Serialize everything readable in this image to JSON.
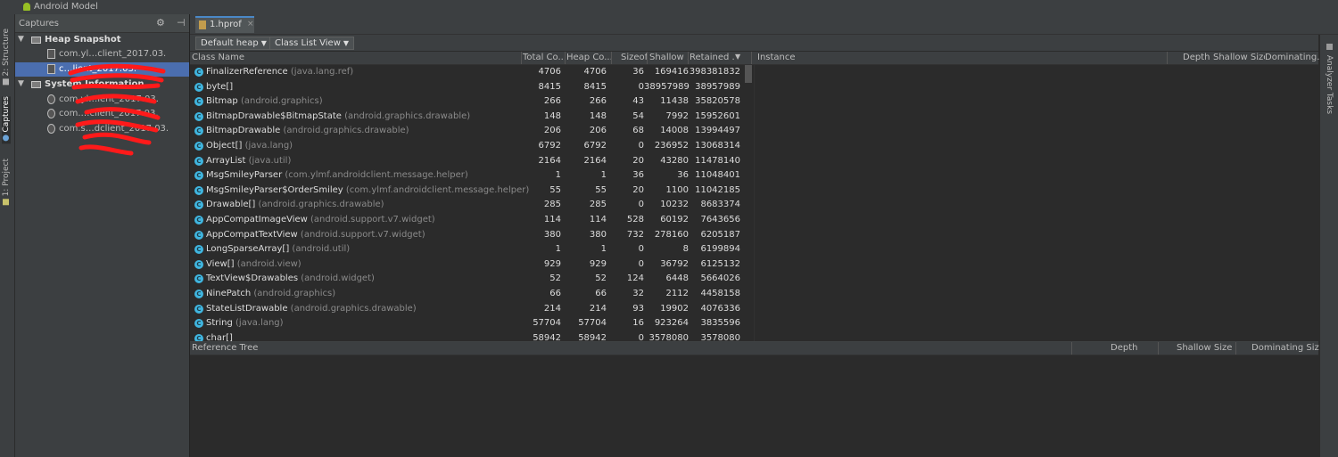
{
  "window": {
    "title": "Android Model"
  },
  "left_tool_tabs": [
    {
      "label": "2: Structure",
      "icon": "structure-icon"
    },
    {
      "label": "Captures",
      "icon": "captures-icon"
    },
    {
      "label": "1: Project",
      "icon": "project-icon"
    }
  ],
  "captures": {
    "title": "Captures",
    "settings_icon": "⚙",
    "pin_icon": "⊣",
    "tree": [
      {
        "label": "Heap Snapshot",
        "type": "folder",
        "expanded": true
      },
      {
        "label": "com.yl…client_2017.03.",
        "type": "file"
      },
      {
        "label": "c…lient_2017.03.",
        "type": "file",
        "selected": true
      },
      {
        "label": "System Information",
        "type": "folder",
        "expanded": true
      },
      {
        "label": "com.yl…ient_2017.03.",
        "type": "file"
      },
      {
        "label": "com.…client_2017.03.",
        "type": "file"
      },
      {
        "label": "com.s…dclient_2017.03.",
        "type": "file"
      }
    ]
  },
  "editor": {
    "tab_label": "1.hprof",
    "close": "×"
  },
  "toolbar": {
    "heap_select": "Default heap",
    "view_select": "Class List View"
  },
  "class_table": {
    "columns": [
      "Class Name",
      "Total Co...",
      "Heap Co...",
      "Sizeof",
      "Shallow ...",
      "Retained ..."
    ],
    "sort_indicator": "▼",
    "rows": [
      {
        "name": "FinalizerReference",
        "pkg": "(java.lang.ref)",
        "total": "4706",
        "heap": "4706",
        "sizeof": "36",
        "shallow": "169416",
        "retained": "398381832"
      },
      {
        "name": "byte[]",
        "pkg": "",
        "total": "8415",
        "heap": "8415",
        "sizeof": "0",
        "shallow": "38957989",
        "retained": "38957989"
      },
      {
        "name": "Bitmap",
        "pkg": "(android.graphics)",
        "total": "266",
        "heap": "266",
        "sizeof": "43",
        "shallow": "11438",
        "retained": "35820578"
      },
      {
        "name": "BitmapDrawable$BitmapState",
        "pkg": "(android.graphics.drawable)",
        "total": "148",
        "heap": "148",
        "sizeof": "54",
        "shallow": "7992",
        "retained": "15952601"
      },
      {
        "name": "BitmapDrawable",
        "pkg": "(android.graphics.drawable)",
        "total": "206",
        "heap": "206",
        "sizeof": "68",
        "shallow": "14008",
        "retained": "13994497"
      },
      {
        "name": "Object[]",
        "pkg": "(java.lang)",
        "total": "6792",
        "heap": "6792",
        "sizeof": "0",
        "shallow": "236952",
        "retained": "13068314"
      },
      {
        "name": "ArrayList",
        "pkg": "(java.util)",
        "total": "2164",
        "heap": "2164",
        "sizeof": "20",
        "shallow": "43280",
        "retained": "11478140"
      },
      {
        "name": "MsgSmileyParser",
        "pkg": "(com.ylmf.androidclient.message.helper)",
        "total": "1",
        "heap": "1",
        "sizeof": "36",
        "shallow": "36",
        "retained": "11048401"
      },
      {
        "name": "MsgSmileyParser$OrderSmiley",
        "pkg": "(com.ylmf.androidclient.message.helper)",
        "total": "55",
        "heap": "55",
        "sizeof": "20",
        "shallow": "1100",
        "retained": "11042185"
      },
      {
        "name": "Drawable[]",
        "pkg": "(android.graphics.drawable)",
        "total": "285",
        "heap": "285",
        "sizeof": "0",
        "shallow": "10232",
        "retained": "8683374"
      },
      {
        "name": "AppCompatImageView",
        "pkg": "(android.support.v7.widget)",
        "total": "114",
        "heap": "114",
        "sizeof": "528",
        "shallow": "60192",
        "retained": "7643656"
      },
      {
        "name": "AppCompatTextView",
        "pkg": "(android.support.v7.widget)",
        "total": "380",
        "heap": "380",
        "sizeof": "732",
        "shallow": "278160",
        "retained": "6205187"
      },
      {
        "name": "LongSparseArray[]",
        "pkg": "(android.util)",
        "total": "1",
        "heap": "1",
        "sizeof": "0",
        "shallow": "8",
        "retained": "6199894"
      },
      {
        "name": "View[]",
        "pkg": "(android.view)",
        "total": "929",
        "heap": "929",
        "sizeof": "0",
        "shallow": "36792",
        "retained": "6125132"
      },
      {
        "name": "TextView$Drawables",
        "pkg": "(android.widget)",
        "total": "52",
        "heap": "52",
        "sizeof": "124",
        "shallow": "6448",
        "retained": "5664026"
      },
      {
        "name": "NinePatch",
        "pkg": "(android.graphics)",
        "total": "66",
        "heap": "66",
        "sizeof": "32",
        "shallow": "2112",
        "retained": "4458158"
      },
      {
        "name": "StateListDrawable",
        "pkg": "(android.graphics.drawable)",
        "total": "214",
        "heap": "214",
        "sizeof": "93",
        "shallow": "19902",
        "retained": "4076336"
      },
      {
        "name": "String",
        "pkg": "(java.lang)",
        "total": "57704",
        "heap": "57704",
        "sizeof": "16",
        "shallow": "923264",
        "retained": "3835596"
      },
      {
        "name": "char[]",
        "pkg": "",
        "total": "58942",
        "heap": "58942",
        "sizeof": "0",
        "shallow": "3578080",
        "retained": "3578080"
      }
    ]
  },
  "instance_table": {
    "columns": [
      "Instance",
      "Depth",
      "Shallow Size",
      "Dominating..."
    ]
  },
  "reference_tree": {
    "columns": [
      "Reference Tree",
      "Depth",
      "Shallow Size",
      "Dominating Size"
    ]
  },
  "right_tool_tabs": [
    {
      "label": "Analyzer Tasks",
      "icon": "analyzer-icon"
    }
  ],
  "colors": {
    "selection": "#4b6eaf",
    "class_icon": "#40b6e0",
    "background": "#2b2b2b",
    "panel": "#3c3f41",
    "scribble": "#ff1a1a"
  }
}
